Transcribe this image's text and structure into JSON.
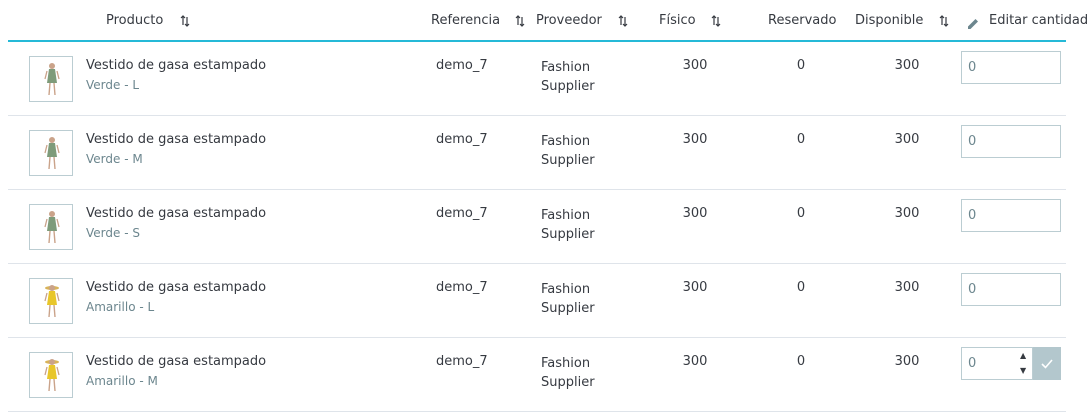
{
  "header": {
    "product": "Producto",
    "reference": "Referencia",
    "supplier": "Proveedor",
    "physical": "Físico",
    "reserved": "Reservado",
    "available": "Disponible",
    "edit_quantity": "Editar cantidad"
  },
  "colors": {
    "accent": "#25b9d7",
    "border": "#dfe4ea",
    "muted": "#6c868e",
    "confirm": "#b3c7cd"
  },
  "rows": [
    {
      "name": "Vestido de gasa estampado",
      "combination": "Verde - L",
      "reference": "demo_7",
      "supplier_line1": "Fashion",
      "supplier_line2": "Supplier",
      "physical": "300",
      "reserved": "0",
      "available": "300",
      "qty": "0",
      "dress": "green"
    },
    {
      "name": "Vestido de gasa estampado",
      "combination": "Verde - M",
      "reference": "demo_7",
      "supplier_line1": "Fashion",
      "supplier_line2": "Supplier",
      "physical": "300",
      "reserved": "0",
      "available": "300",
      "qty": "0",
      "dress": "green"
    },
    {
      "name": "Vestido de gasa estampado",
      "combination": "Verde - S",
      "reference": "demo_7",
      "supplier_line1": "Fashion",
      "supplier_line2": "Supplier",
      "physical": "300",
      "reserved": "0",
      "available": "300",
      "qty": "0",
      "dress": "green"
    },
    {
      "name": "Vestido de gasa estampado",
      "combination": "Amarillo - L",
      "reference": "demo_7",
      "supplier_line1": "Fashion",
      "supplier_line2": "Supplier",
      "physical": "300",
      "reserved": "0",
      "available": "300",
      "qty": "0",
      "dress": "yellow"
    },
    {
      "name": "Vestido de gasa estampado",
      "combination": "Amarillo - M",
      "reference": "demo_7",
      "supplier_line1": "Fashion",
      "supplier_line2": "Supplier",
      "physical": "300",
      "reserved": "0",
      "available": "300",
      "qty": "0",
      "dress": "yellow",
      "active": true
    }
  ]
}
